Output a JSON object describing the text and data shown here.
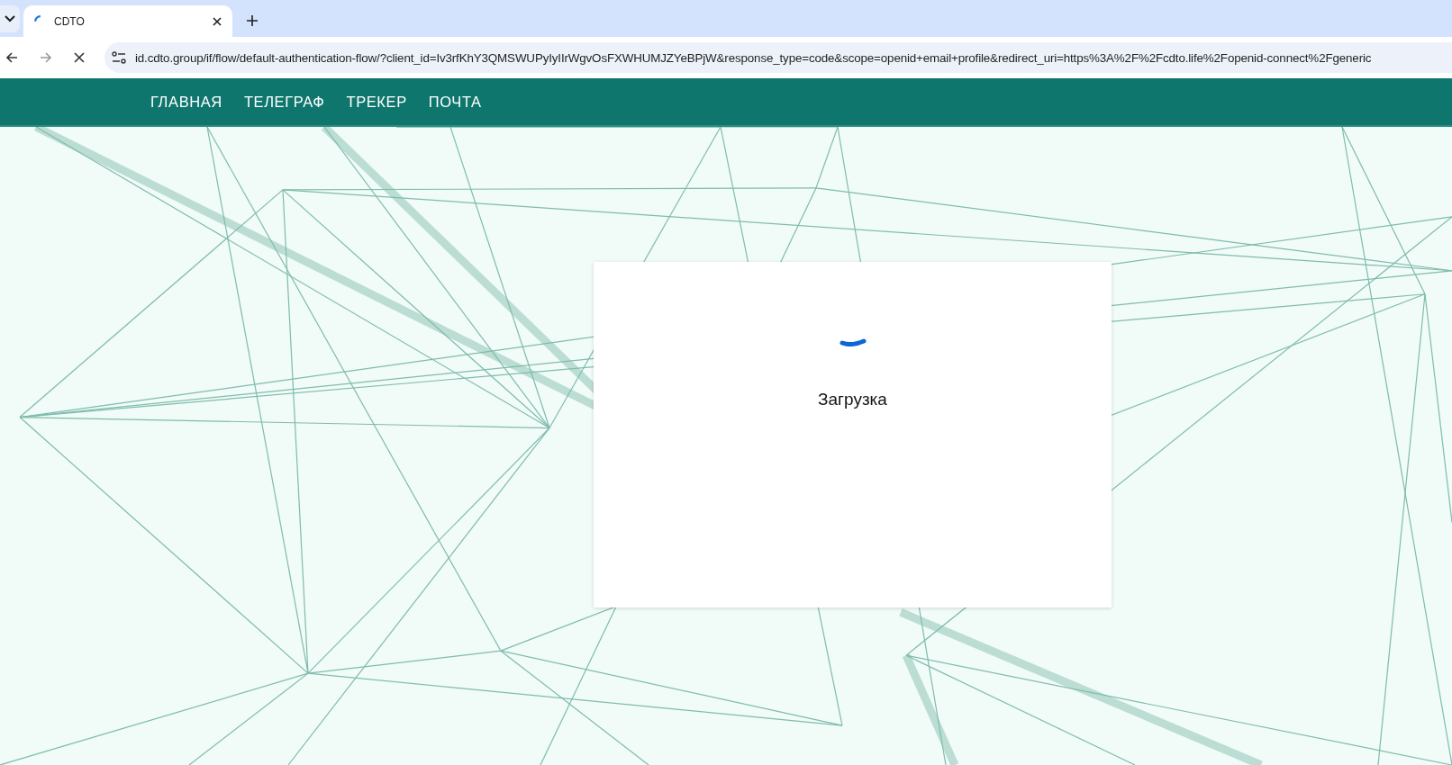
{
  "browser": {
    "tabs": [
      {
        "title": "CDTO",
        "selected": true,
        "loading": true
      }
    ],
    "url": "id.cdto.group/if/flow/default-authentication-flow/?client_id=Iv3rfKhY3QMSWUPyIyIIrWgvOsFXWHUMJZYeBPjW&response_type=code&scope=openid+email+profile&redirect_uri=https%3A%2F%2Fcdto.life%2Fopenid-connect%2Fgeneric"
  },
  "nav": {
    "items": [
      {
        "label": "ГЛАВНАЯ"
      },
      {
        "label": "ТЕЛЕГРАФ"
      },
      {
        "label": "ТРЕКЕР"
      },
      {
        "label": "ПОЧТА"
      }
    ]
  },
  "card": {
    "message": "Загрузка"
  }
}
